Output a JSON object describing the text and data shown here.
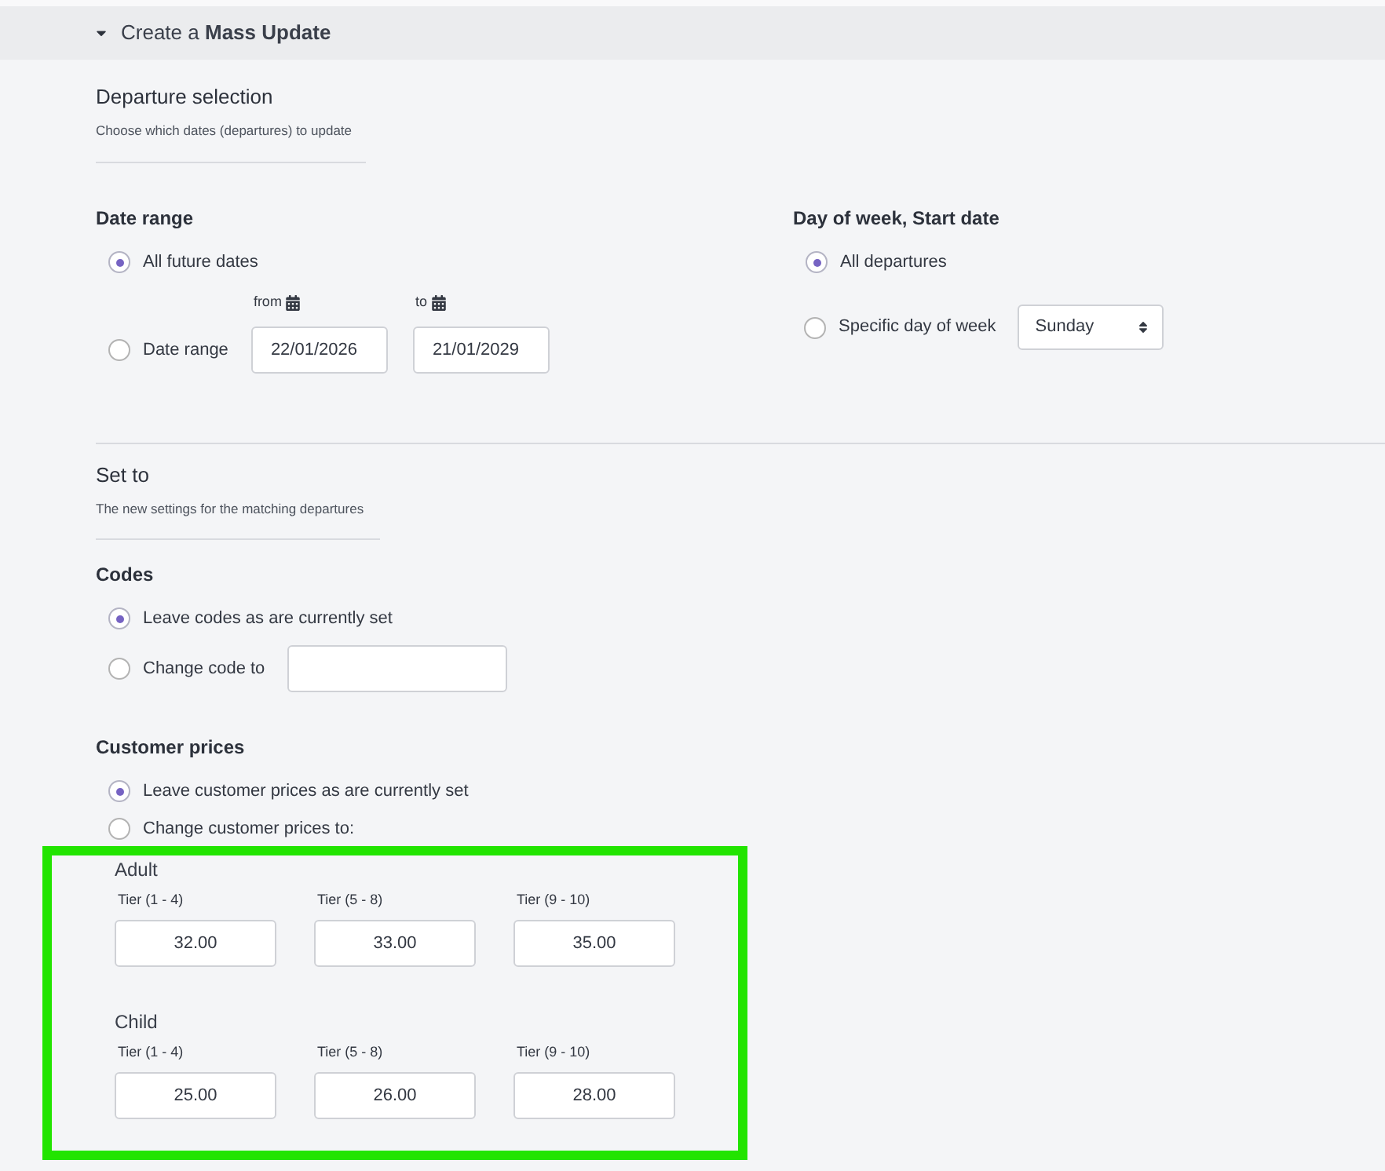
{
  "header": {
    "title": "Create a **Mass Update**",
    "expanded": true
  },
  "departure_selection": {
    "title": "Departure selection",
    "subtitle": "Choose which dates (departures) to update",
    "date_range": {
      "label": "Date range",
      "options": [
        {
          "kind": "plain",
          "label": "All future dates",
          "selected": true
        },
        {
          "kind": "date_range",
          "label": "Date range",
          "selected": false,
          "from": {
            "label": "from",
            "value": "22/01/2026"
          },
          "to": {
            "label": "to",
            "value": "21/01/2029"
          }
        }
      ]
    },
    "day_of_week": {
      "label": "Day of week, Start date",
      "options": [
        {
          "kind": "plain",
          "label": "All departures",
          "selected": true
        },
        {
          "kind": "select",
          "label": "Specific day of week",
          "selected": false,
          "value": "Sunday"
        }
      ]
    }
  },
  "set_to": {
    "title": "Set to",
    "subtitle": "The new settings for the matching departures",
    "codes": {
      "label": "Codes",
      "options": [
        {
          "kind": "plain",
          "label": "Leave codes as are currently set",
          "selected": true
        },
        {
          "kind": "input",
          "label": "Change code to",
          "selected": false
        }
      ]
    },
    "customer_prices": {
      "label": "Customer prices",
      "options": [
        {
          "kind": "plain",
          "label": "Leave customer prices as are currently set",
          "selected": true
        },
        {
          "kind": "plain",
          "label": "Change customer prices to:",
          "selected": false
        }
      ],
      "groups": [
        {
          "label": "Adult",
          "tiers": [
            {
              "label": "Tier (1 - 4)",
              "value": "32.00"
            },
            {
              "label": "Tier (5 - 8)",
              "value": "33.00"
            },
            {
              "label": "Tier (9 - 10)",
              "value": "35.00"
            }
          ]
        },
        {
          "label": "Child",
          "tiers": [
            {
              "label": "Tier (1 - 4)",
              "value": "25.00"
            },
            {
              "label": "Tier (5 - 8)",
              "value": "26.00"
            },
            {
              "label": "Tier (9 - 10)",
              "value": "28.00"
            }
          ]
        }
      ]
    }
  }
}
